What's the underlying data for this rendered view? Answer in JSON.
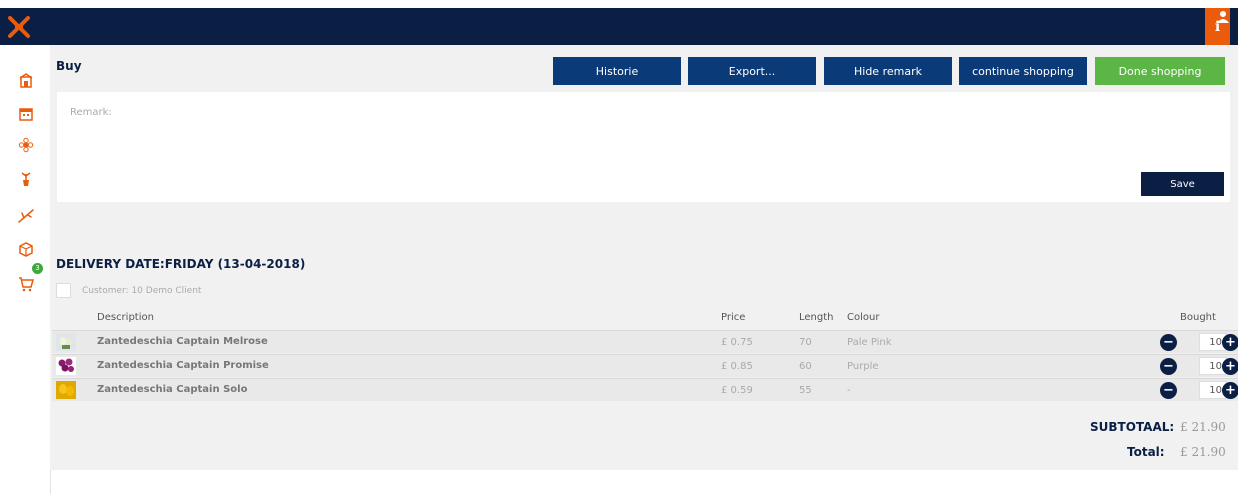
{
  "header": {
    "logo": "logo-x-icon",
    "info_label": "i",
    "user_icon": "user-icon"
  },
  "sidebar": {
    "icons": [
      "building-icon",
      "calendar-icon",
      "flower-icon",
      "plant-pot-icon",
      "branch-icon",
      "box-icon",
      "cart-icon"
    ],
    "cart_badge": "3"
  },
  "toolbar": {
    "title": "Buy",
    "buttons": [
      "Historie",
      "Export...",
      "Hide remark",
      "continue shopping",
      "Done shopping"
    ]
  },
  "remark": {
    "label": "Remark:",
    "save_label": "Save"
  },
  "delivery": {
    "title": "DELIVERY DATE:FRIDAY (13-04-2018)",
    "customer": "Customer: 10 Demo Client"
  },
  "table": {
    "headers": {
      "description": "Description",
      "price": "Price",
      "length": "Length",
      "colour": "Colour",
      "bought": "Bought"
    },
    "rows": [
      {
        "description": "Zantedeschia Captain Melrose",
        "price": "£ 0.75",
        "length": "70",
        "colour": "Pale Pink",
        "qty": "10"
      },
      {
        "description": "Zantedeschia Captain Promise",
        "price": "£ 0.85",
        "length": "60",
        "colour": "Purple",
        "qty": "10"
      },
      {
        "description": "Zantedeschia Captain Solo",
        "price": "£ 0.59",
        "length": "55",
        "colour": "-",
        "qty": "10"
      }
    ]
  },
  "totals": {
    "subtotal_label": "SUBTOTAAL:",
    "subtotal_value": "£ 21.90",
    "total_label": "Total:",
    "total_value": "£ 21.90"
  },
  "colors": {
    "navy": "#0b1f45",
    "button_blue": "#0b3a78",
    "green": "#5cb646",
    "orange": "#ea5b0c"
  }
}
